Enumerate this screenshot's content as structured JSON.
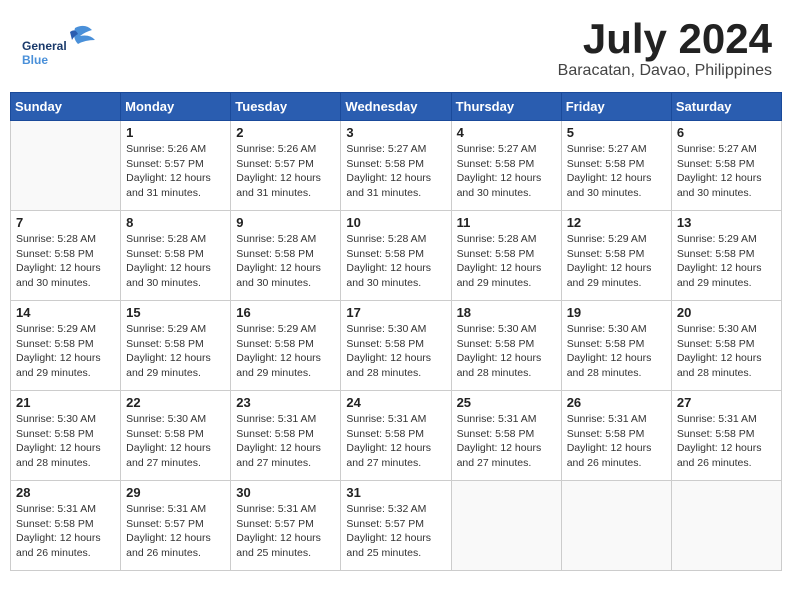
{
  "header": {
    "logo_general": "General",
    "logo_blue": "Blue",
    "month_title": "July 2024",
    "location": "Baracatan, Davao, Philippines"
  },
  "weekdays": [
    "Sunday",
    "Monday",
    "Tuesday",
    "Wednesday",
    "Thursday",
    "Friday",
    "Saturday"
  ],
  "weeks": [
    [
      {
        "day": "",
        "info": ""
      },
      {
        "day": "1",
        "info": "Sunrise: 5:26 AM\nSunset: 5:57 PM\nDaylight: 12 hours\nand 31 minutes."
      },
      {
        "day": "2",
        "info": "Sunrise: 5:26 AM\nSunset: 5:57 PM\nDaylight: 12 hours\nand 31 minutes."
      },
      {
        "day": "3",
        "info": "Sunrise: 5:27 AM\nSunset: 5:58 PM\nDaylight: 12 hours\nand 31 minutes."
      },
      {
        "day": "4",
        "info": "Sunrise: 5:27 AM\nSunset: 5:58 PM\nDaylight: 12 hours\nand 30 minutes."
      },
      {
        "day": "5",
        "info": "Sunrise: 5:27 AM\nSunset: 5:58 PM\nDaylight: 12 hours\nand 30 minutes."
      },
      {
        "day": "6",
        "info": "Sunrise: 5:27 AM\nSunset: 5:58 PM\nDaylight: 12 hours\nand 30 minutes."
      }
    ],
    [
      {
        "day": "7",
        "info": "Sunrise: 5:28 AM\nSunset: 5:58 PM\nDaylight: 12 hours\nand 30 minutes."
      },
      {
        "day": "8",
        "info": "Sunrise: 5:28 AM\nSunset: 5:58 PM\nDaylight: 12 hours\nand 30 minutes."
      },
      {
        "day": "9",
        "info": "Sunrise: 5:28 AM\nSunset: 5:58 PM\nDaylight: 12 hours\nand 30 minutes."
      },
      {
        "day": "10",
        "info": "Sunrise: 5:28 AM\nSunset: 5:58 PM\nDaylight: 12 hours\nand 30 minutes."
      },
      {
        "day": "11",
        "info": "Sunrise: 5:28 AM\nSunset: 5:58 PM\nDaylight: 12 hours\nand 29 minutes."
      },
      {
        "day": "12",
        "info": "Sunrise: 5:29 AM\nSunset: 5:58 PM\nDaylight: 12 hours\nand 29 minutes."
      },
      {
        "day": "13",
        "info": "Sunrise: 5:29 AM\nSunset: 5:58 PM\nDaylight: 12 hours\nand 29 minutes."
      }
    ],
    [
      {
        "day": "14",
        "info": "Sunrise: 5:29 AM\nSunset: 5:58 PM\nDaylight: 12 hours\nand 29 minutes."
      },
      {
        "day": "15",
        "info": "Sunrise: 5:29 AM\nSunset: 5:58 PM\nDaylight: 12 hours\nand 29 minutes."
      },
      {
        "day": "16",
        "info": "Sunrise: 5:29 AM\nSunset: 5:58 PM\nDaylight: 12 hours\nand 29 minutes."
      },
      {
        "day": "17",
        "info": "Sunrise: 5:30 AM\nSunset: 5:58 PM\nDaylight: 12 hours\nand 28 minutes."
      },
      {
        "day": "18",
        "info": "Sunrise: 5:30 AM\nSunset: 5:58 PM\nDaylight: 12 hours\nand 28 minutes."
      },
      {
        "day": "19",
        "info": "Sunrise: 5:30 AM\nSunset: 5:58 PM\nDaylight: 12 hours\nand 28 minutes."
      },
      {
        "day": "20",
        "info": "Sunrise: 5:30 AM\nSunset: 5:58 PM\nDaylight: 12 hours\nand 28 minutes."
      }
    ],
    [
      {
        "day": "21",
        "info": "Sunrise: 5:30 AM\nSunset: 5:58 PM\nDaylight: 12 hours\nand 28 minutes."
      },
      {
        "day": "22",
        "info": "Sunrise: 5:30 AM\nSunset: 5:58 PM\nDaylight: 12 hours\nand 27 minutes."
      },
      {
        "day": "23",
        "info": "Sunrise: 5:31 AM\nSunset: 5:58 PM\nDaylight: 12 hours\nand 27 minutes."
      },
      {
        "day": "24",
        "info": "Sunrise: 5:31 AM\nSunset: 5:58 PM\nDaylight: 12 hours\nand 27 minutes."
      },
      {
        "day": "25",
        "info": "Sunrise: 5:31 AM\nSunset: 5:58 PM\nDaylight: 12 hours\nand 27 minutes."
      },
      {
        "day": "26",
        "info": "Sunrise: 5:31 AM\nSunset: 5:58 PM\nDaylight: 12 hours\nand 26 minutes."
      },
      {
        "day": "27",
        "info": "Sunrise: 5:31 AM\nSunset: 5:58 PM\nDaylight: 12 hours\nand 26 minutes."
      }
    ],
    [
      {
        "day": "28",
        "info": "Sunrise: 5:31 AM\nSunset: 5:58 PM\nDaylight: 12 hours\nand 26 minutes."
      },
      {
        "day": "29",
        "info": "Sunrise: 5:31 AM\nSunset: 5:57 PM\nDaylight: 12 hours\nand 26 minutes."
      },
      {
        "day": "30",
        "info": "Sunrise: 5:31 AM\nSunset: 5:57 PM\nDaylight: 12 hours\nand 25 minutes."
      },
      {
        "day": "31",
        "info": "Sunrise: 5:32 AM\nSunset: 5:57 PM\nDaylight: 12 hours\nand 25 minutes."
      },
      {
        "day": "",
        "info": ""
      },
      {
        "day": "",
        "info": ""
      },
      {
        "day": "",
        "info": ""
      }
    ]
  ]
}
